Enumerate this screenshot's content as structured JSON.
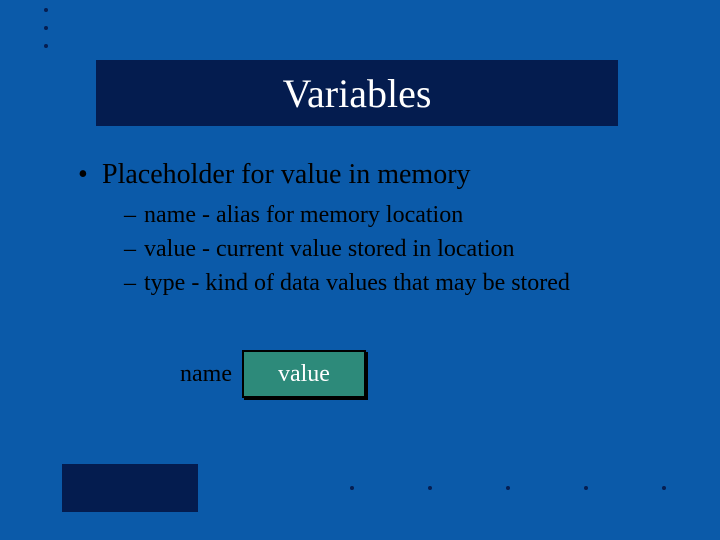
{
  "title": "Variables",
  "bullets": {
    "main": "Placeholder for value in memory",
    "sub": [
      "name - alias for memory location",
      "value - current value stored in location",
      "type - kind of data values that may be stored"
    ]
  },
  "diagram": {
    "name_label": "name",
    "value_label": "value"
  },
  "colors": {
    "background": "#0b5aa9",
    "title_band": "#041c4f",
    "value_box": "#2d8a7a"
  }
}
